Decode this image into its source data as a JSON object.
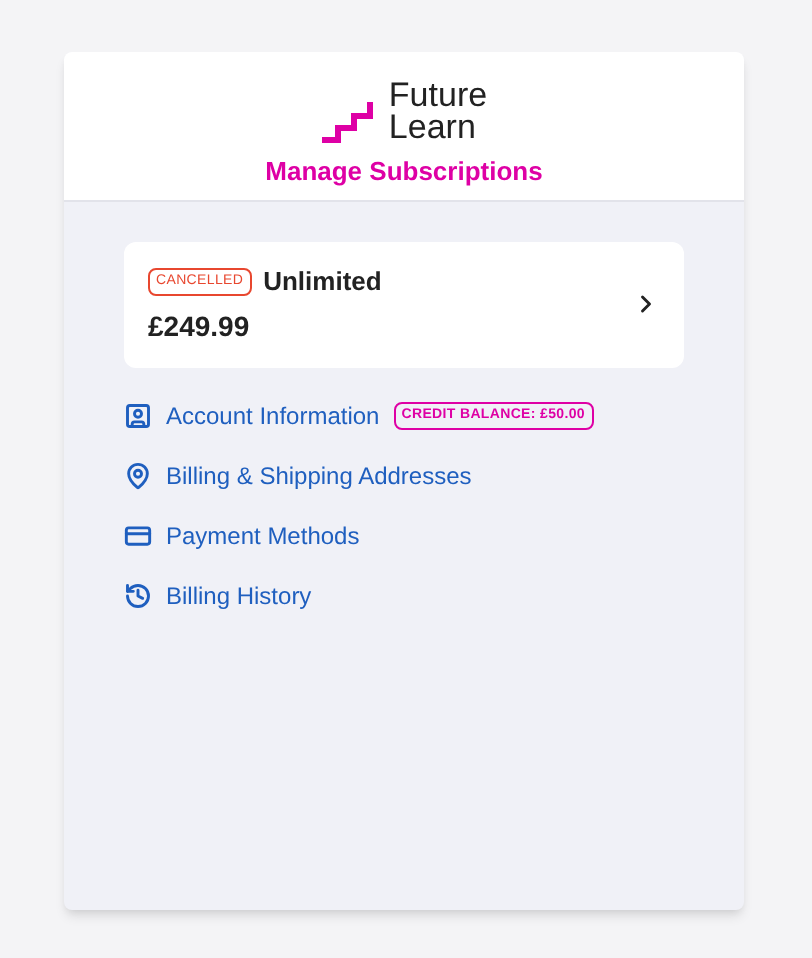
{
  "logo": {
    "line_1": "Future",
    "line_2": "Learn"
  },
  "title": "Manage Subscriptions",
  "subscription": {
    "status": "CANCELLED",
    "plan": "Unlimited",
    "price": "£249.99"
  },
  "menu": [
    {
      "kind": "account",
      "label": "Account Information",
      "badge": "CREDIT BALANCE: £50.00"
    },
    {
      "kind": "address",
      "label": "Billing & Shipping Addresses"
    },
    {
      "kind": "payment",
      "label": "Payment Methods"
    },
    {
      "kind": "history",
      "label": "Billing History"
    }
  ]
}
